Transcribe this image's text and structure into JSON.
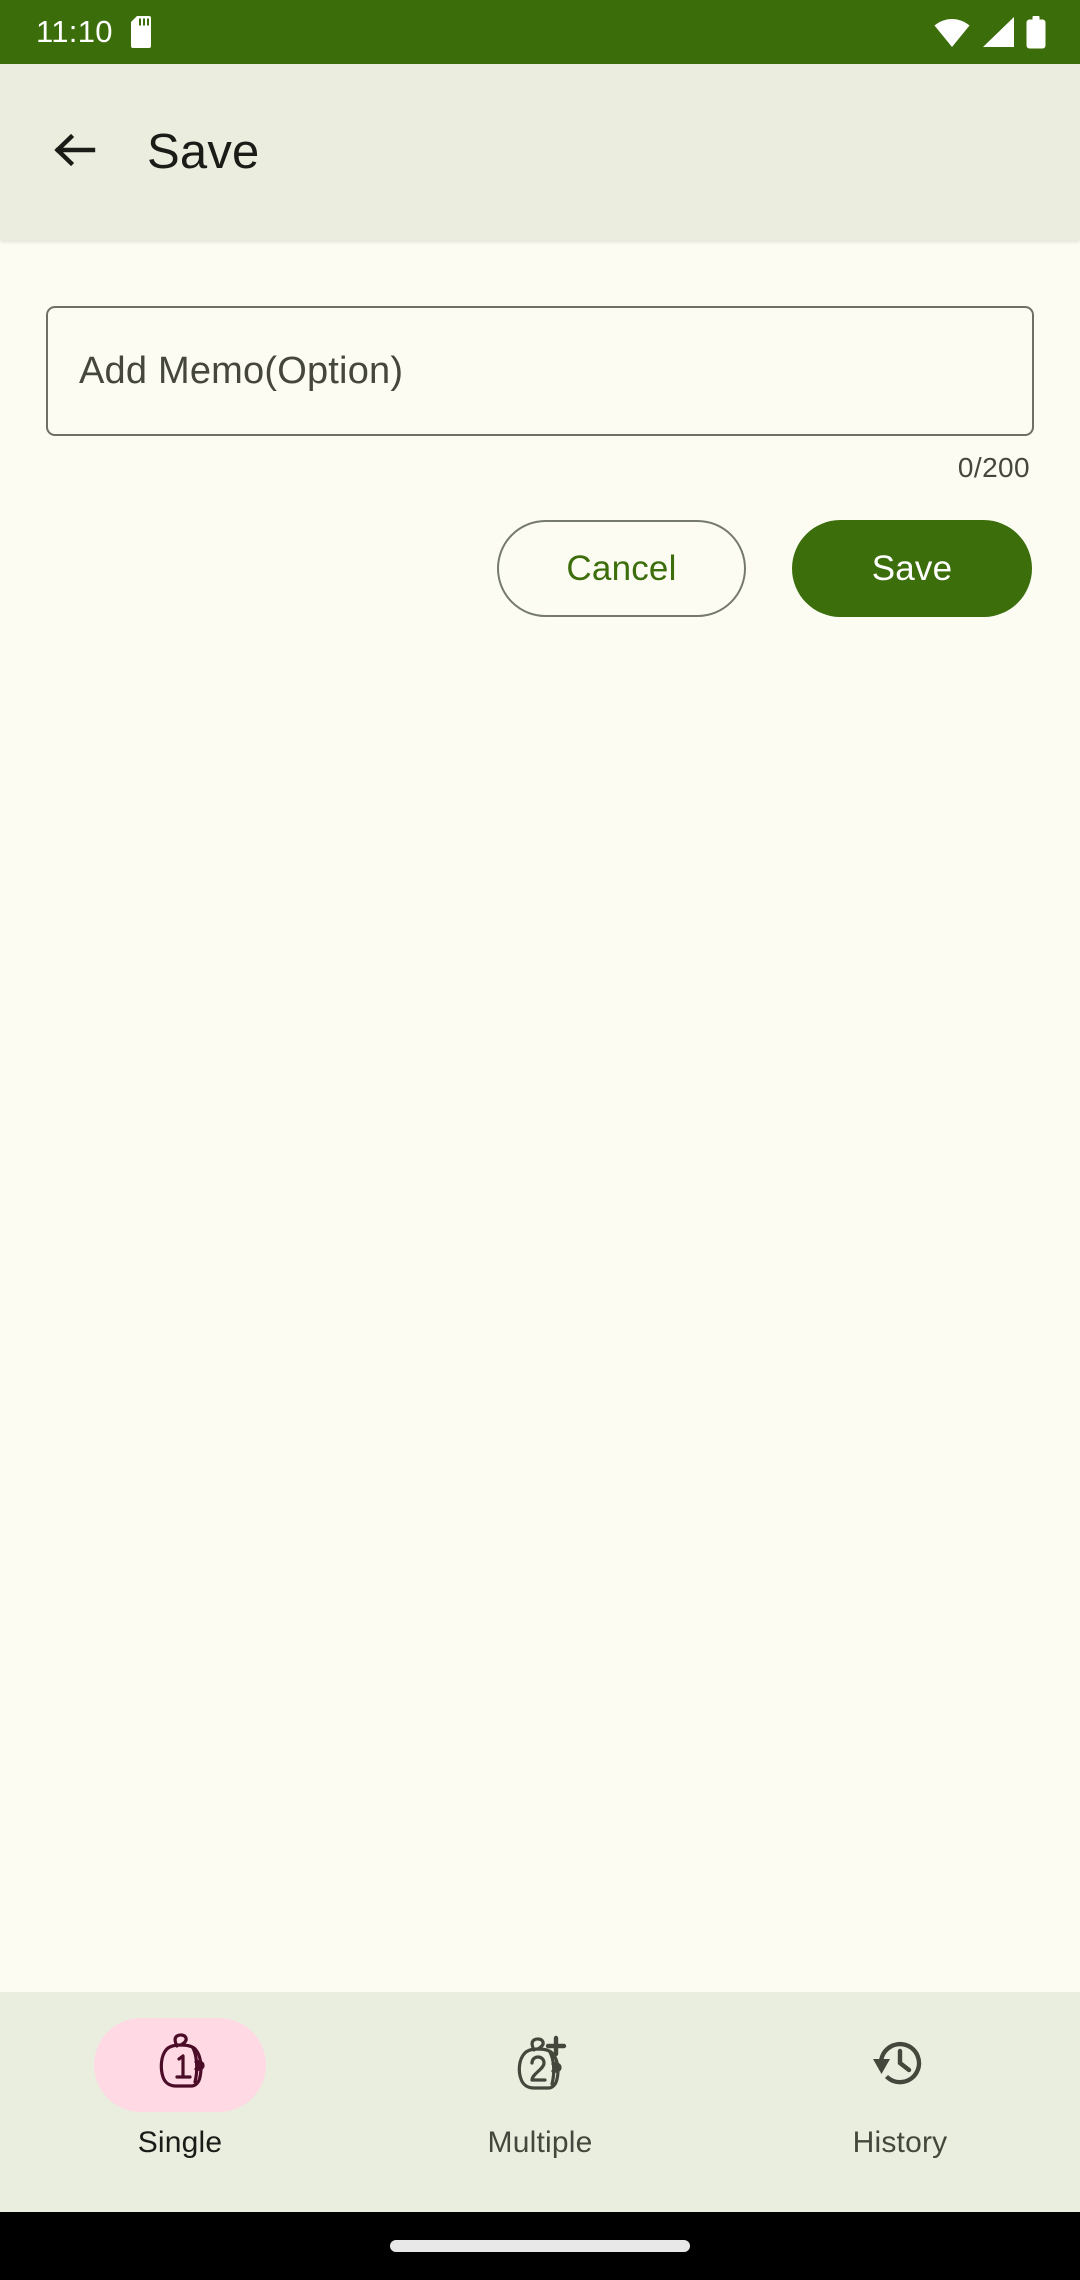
{
  "status_bar": {
    "time": "11:10",
    "icons": [
      "sd-card-icon",
      "wifi-icon",
      "cellular-signal-icon",
      "battery-icon"
    ],
    "background_color": "#3B6E0A",
    "foreground_color": "#FFFFFF"
  },
  "app_bar": {
    "back_icon": "back-arrow-icon",
    "title": "Save",
    "background_color": "#EBEEDF"
  },
  "main": {
    "memo_field": {
      "value": "",
      "placeholder": "Add Memo(Option)",
      "char_counter": "0/200",
      "max_length": 200
    },
    "buttons": {
      "cancel_label": "Cancel",
      "save_label": "Save",
      "cancel_text_color": "#3C6E0B",
      "save_background_color": "#3C6E0B",
      "save_text_color": "#FFFFFF"
    },
    "background_color": "#FCFCF3"
  },
  "bottom_nav": {
    "background_color": "#E9EEDF",
    "active_pill_color": "#FFD9E3",
    "items": [
      {
        "label": "Single",
        "icon": "tag-one-icon",
        "active": true
      },
      {
        "label": "Multiple",
        "icon": "tag-two-plus-icon",
        "active": false
      },
      {
        "label": "History",
        "icon": "history-clock-icon",
        "active": false
      }
    ]
  },
  "gesture_bar": {
    "handle": "home-gesture-handle",
    "background_color": "#000000"
  }
}
